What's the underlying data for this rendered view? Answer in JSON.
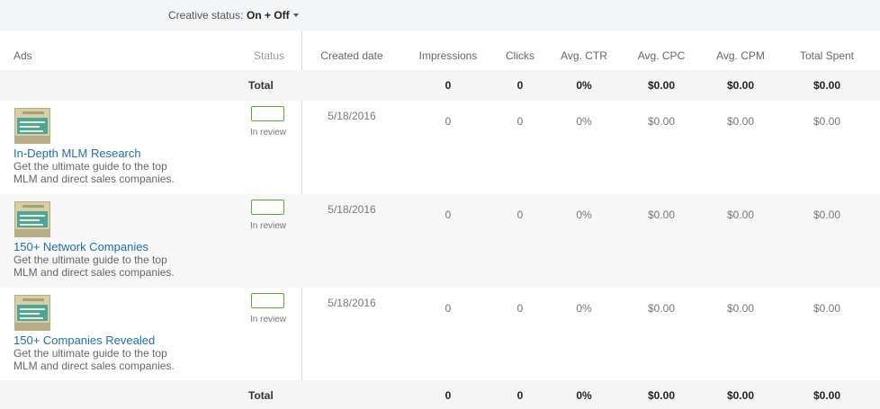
{
  "filter": {
    "label": "Creative status:",
    "value": "On + Off"
  },
  "columns": {
    "ads": "Ads",
    "status": "Status",
    "created": "Created date",
    "impressions": "Impressions",
    "clicks": "Clicks",
    "ctr": "Avg. CTR",
    "cpc": "Avg. CPC",
    "cpm": "Avg. CPM",
    "spent": "Total Spent"
  },
  "totals": {
    "label": "Total",
    "impressions": "0",
    "clicks": "0",
    "ctr": "0%",
    "cpc": "$0.00",
    "cpm": "$0.00",
    "spent": "$0.00"
  },
  "ads": [
    {
      "title": "In-Depth MLM Research",
      "description": "Get the ultimate guide to the top MLM and direct sales companies.",
      "status": "In review",
      "created": "5/18/2016",
      "impressions": "0",
      "clicks": "0",
      "ctr": "0%",
      "cpc": "$0.00",
      "cpm": "$0.00",
      "spent": "$0.00"
    },
    {
      "title": "150+ Network Companies",
      "description": "Get the ultimate guide to the top MLM and direct sales companies.",
      "status": "In review",
      "created": "5/18/2016",
      "impressions": "0",
      "clicks": "0",
      "ctr": "0%",
      "cpc": "$0.00",
      "cpm": "$0.00",
      "spent": "$0.00"
    },
    {
      "title": "150+ Companies Revealed",
      "description": "Get the ultimate guide to the top MLM and direct sales companies.",
      "status": "In review",
      "created": "5/18/2016",
      "impressions": "0",
      "clicks": "0",
      "ctr": "0%",
      "cpc": "$0.00",
      "cpm": "$0.00",
      "spent": "$0.00"
    }
  ],
  "colors": {
    "link": "#1f6fb2",
    "status_border": "#5aa832"
  }
}
